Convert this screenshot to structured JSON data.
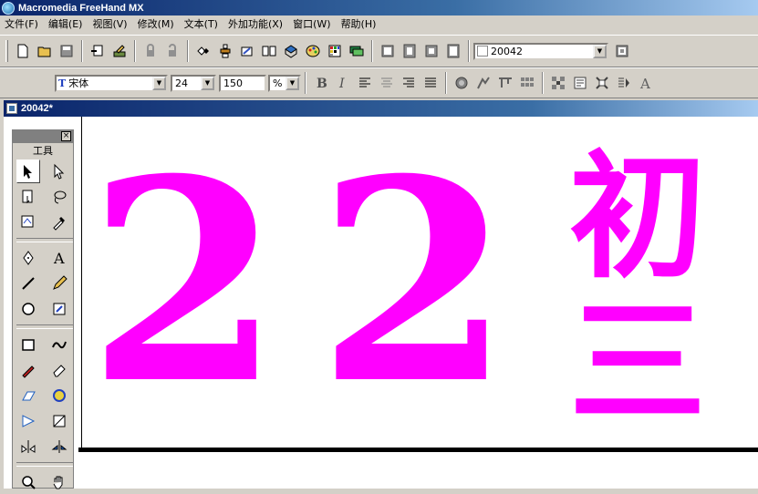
{
  "app": {
    "title": "Macromedia FreeHand MX"
  },
  "menu": [
    {
      "label": "文件(F)"
    },
    {
      "label": "编辑(E)"
    },
    {
      "label": "视图(V)"
    },
    {
      "label": "修改(M)"
    },
    {
      "label": "文本(T)"
    },
    {
      "label": "外加功能(X)"
    },
    {
      "label": "窗口(W)"
    },
    {
      "label": "帮助(H)"
    }
  ],
  "main_toolbar": {
    "icons": [
      "new-file-icon",
      "open-icon",
      "save-icon",
      "import-icon",
      "export-icon",
      "lock-icon",
      "unlock-icon",
      "group-icon",
      "align-icon",
      "transform-icon",
      "library-icon",
      "symbols-icon",
      "color-mixer-icon",
      "swatches-icon",
      "layers-icon",
      "page-icon",
      "fit-page-icon",
      "fit-selection-icon",
      "fit-all-icon",
      "page-tool-icon"
    ],
    "document_selector": {
      "value": "20042"
    }
  },
  "text_toolbar": {
    "font_name": "宋体",
    "font_size": "24",
    "leading": "150",
    "leading_unit": "%",
    "icons": [
      "bold-icon",
      "italic-icon",
      "align-left-icon",
      "align-center-icon",
      "align-right-icon",
      "justify-icon",
      "effects-icon",
      "kerning-icon",
      "baseline-icon",
      "columns-icon",
      "link-text-icon",
      "convert-to-paths-icon",
      "flow-inside-icon",
      "attach-to-path-icon",
      "text-editor-icon"
    ]
  },
  "document": {
    "title": "20042*",
    "artwork": {
      "digits": "22",
      "chars": [
        "初",
        "三"
      ],
      "color": "#ff00ff"
    }
  },
  "tools_panel": {
    "label": "工具",
    "tools": [
      {
        "name": "pointer-tool",
        "active": true
      },
      {
        "name": "subselect-tool",
        "active": false
      },
      {
        "name": "page-tool",
        "active": false
      },
      {
        "name": "lasso-tool",
        "active": false
      },
      {
        "name": "trace-tool",
        "active": false
      },
      {
        "name": "eyedropper-tool",
        "active": false
      },
      {
        "name": "pen-tool",
        "active": false
      },
      {
        "name": "text-tool",
        "active": false
      },
      {
        "name": "line-tool",
        "active": false
      },
      {
        "name": "pencil-tool",
        "active": false
      },
      {
        "name": "ellipse-tool",
        "active": false
      },
      {
        "name": "scale-tool",
        "active": false
      },
      {
        "name": "rectangle-tool",
        "active": false
      },
      {
        "name": "freeform-tool",
        "active": false
      },
      {
        "name": "knife-tool",
        "active": false
      },
      {
        "name": "eraser-tool",
        "active": false
      },
      {
        "name": "shear-tool",
        "active": false
      },
      {
        "name": "fill-tool",
        "active": false
      },
      {
        "name": "blend-tool",
        "active": false
      },
      {
        "name": "envelope-tool",
        "active": false
      },
      {
        "name": "mirror-tool",
        "active": false
      },
      {
        "name": "reflect-tool",
        "active": false
      },
      {
        "name": "zoom-tool",
        "active": false
      },
      {
        "name": "hand-tool",
        "active": false
      }
    ]
  }
}
